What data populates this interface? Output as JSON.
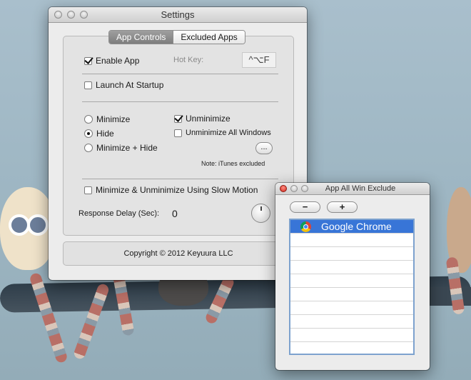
{
  "settings": {
    "title": "Settings",
    "tabs": {
      "app_controls": "App Controls",
      "excluded_apps": "Excluded Apps"
    },
    "enable_app": {
      "label": "Enable App",
      "checked": true
    },
    "hot_key": {
      "label": "Hot Key:",
      "value": "^⌥F"
    },
    "launch_at_startup": {
      "label": "Launch At Startup",
      "checked": false
    },
    "minimize": {
      "label": "Minimize",
      "checked": false
    },
    "hide": {
      "label": "Hide",
      "checked": true
    },
    "minimize_hide": {
      "label": "Minimize + Hide",
      "checked": false
    },
    "unminimize": {
      "label": "Unminimize",
      "checked": true
    },
    "unminimize_all": {
      "label": "Unminimize All Windows",
      "checked": false
    },
    "more_button": "...",
    "note": "Note: iTunes excluded",
    "slow_motion": {
      "label": "Minimize & Unminimize Using Slow Motion",
      "checked": false
    },
    "response_delay": {
      "label": "Response Delay (Sec):",
      "value": "0"
    },
    "footer": "Copyright © 2012 Keyuura LLC"
  },
  "exclude": {
    "title": "App All Win Exclude",
    "remove_label": "−",
    "add_label": "+",
    "items": [
      "Google Chrome"
    ]
  },
  "colors": {
    "selection": "#3875d7",
    "close_button": "#d2281c"
  }
}
